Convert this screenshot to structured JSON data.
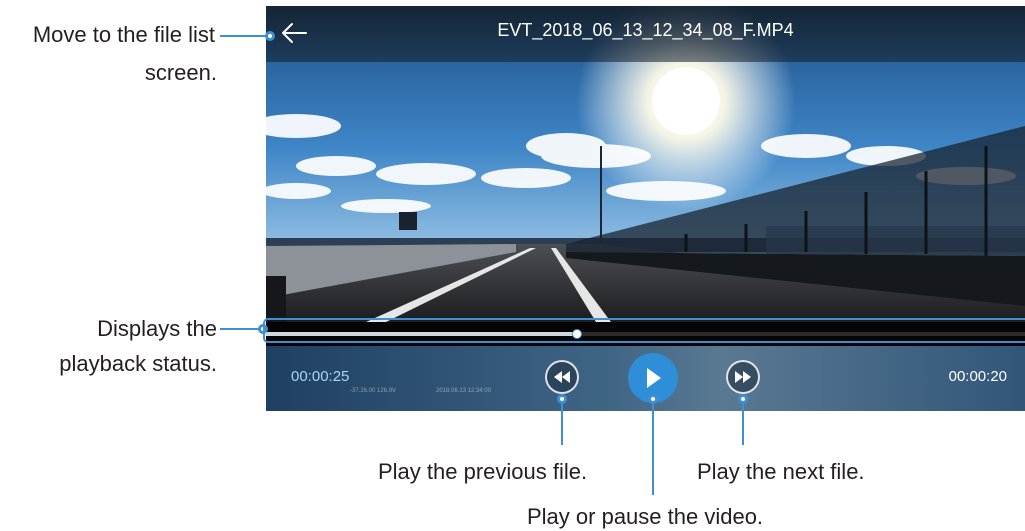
{
  "player": {
    "title": "EVT_2018_06_13_12_34_08_F.MP4",
    "current_time": "00:00:25",
    "total_time": "00:00:20",
    "overlay_info": [
      "-37.26.00 126.9V",
      "2018.06.13 12:34:00"
    ],
    "progress": 0.41,
    "icons": {
      "back": "arrow-left-icon",
      "previous": "rewind-icon",
      "play": "play-icon",
      "next": "fast-forward-icon"
    }
  },
  "callouts": {
    "back_line1": "Move to the file list",
    "back_line2": "screen.",
    "progress_line1": "Displays the",
    "progress_line2": "playback status.",
    "previous": "Play the previous file.",
    "play": "Play or pause the video.",
    "next": "Play the next file."
  },
  "colors": {
    "callout_line": "#3f8fd2",
    "play_button": "#2f8ed8",
    "callout_text": "#231f20"
  }
}
